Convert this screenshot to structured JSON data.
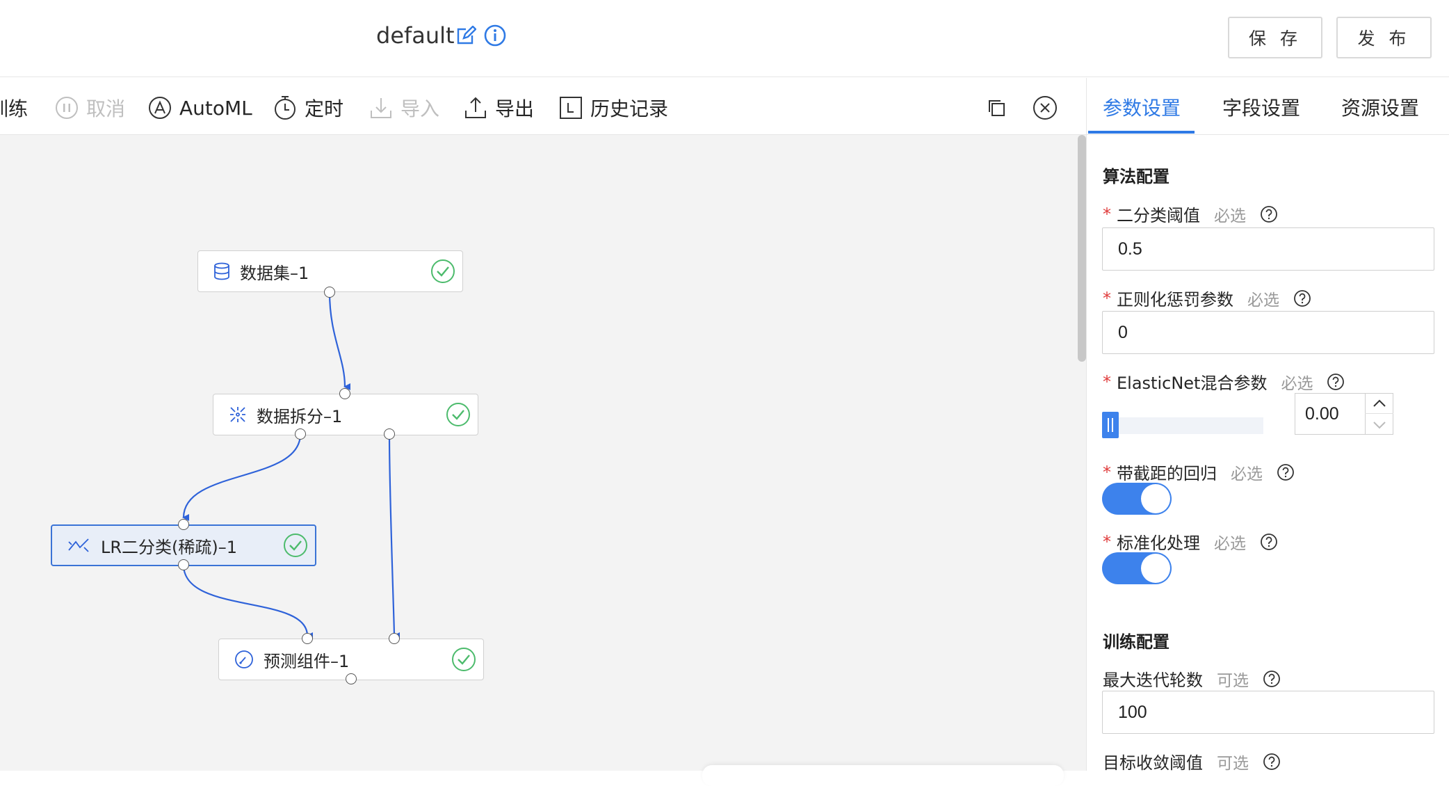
{
  "header": {
    "title": "default",
    "save_label": "保 存",
    "publish_label": "发 布"
  },
  "toolbar": {
    "train_label": "训练",
    "cancel_label": "取消",
    "automl_label": "AutoML",
    "schedule_label": "定时",
    "import_label": "导入",
    "export_label": "导出",
    "history_label": "历史记录"
  },
  "canvas": {
    "nodes": [
      {
        "label": "数据集–1",
        "icon": "database-icon",
        "status": "success"
      },
      {
        "label": "数据拆分–1",
        "icon": "split-icon",
        "status": "success"
      },
      {
        "label": "LR二分类(稀疏)–1",
        "icon": "regression-icon",
        "status": "success"
      },
      {
        "label": "预测组件–1",
        "icon": "gauge-icon",
        "status": "success"
      }
    ]
  },
  "panel": {
    "tabs": [
      "参数设置",
      "字段设置",
      "资源设置"
    ],
    "active_tab": "参数设置",
    "section_algo": "算法配置",
    "section_train": "训练配置",
    "required_tag": "必选",
    "optional_tag": "可选",
    "fields": {
      "threshold": {
        "label": "二分类阈值",
        "value": "0.5"
      },
      "reg_penalty": {
        "label": "正则化惩罚参数",
        "value": "0"
      },
      "elasticnet": {
        "label": "ElasticNet混合参数",
        "value": "0.00",
        "slider_fraction": 0.0
      },
      "intercept": {
        "label": "带截距的回归",
        "enabled": true
      },
      "standardize": {
        "label": "标准化处理",
        "enabled": true
      },
      "max_iter": {
        "label": "最大迭代轮数",
        "value": "100"
      },
      "tol": {
        "label": "目标收敛阈值"
      }
    }
  },
  "colors": {
    "accent": "#2f7ae5",
    "toggle_on": "#3d82ec",
    "success": "#4cbb6c",
    "required": "#e03b3b",
    "edge": "#2e62d9"
  }
}
